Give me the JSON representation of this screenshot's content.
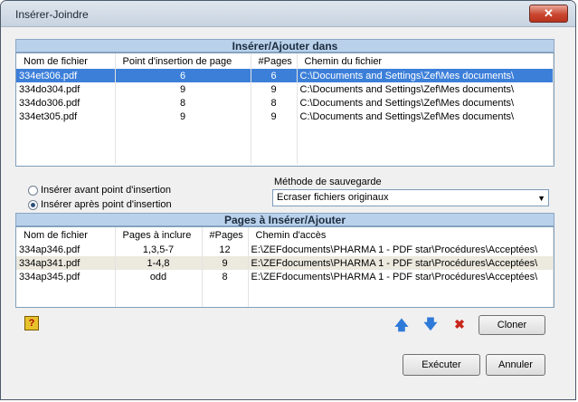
{
  "window": {
    "title": "Insérer-Joindre",
    "close_glyph": "✕"
  },
  "insert_section": {
    "header": "Insérer/Ajouter dans",
    "columns": [
      "Nom de fichier",
      "Point d'insertion de page",
      "#Pages",
      "Chemin du fichier"
    ],
    "rows": [
      [
        "334et306.pdf",
        "6",
        "6",
        "C:\\Documents and Settings\\Zef\\Mes documents\\"
      ],
      [
        "334do304.pdf",
        "9",
        "9",
        "C:\\Documents and Settings\\Zef\\Mes documents\\"
      ],
      [
        "334do306.pdf",
        "8",
        "8",
        "C:\\Documents and Settings\\Zef\\Mes documents\\"
      ],
      [
        "334et305.pdf",
        "9",
        "9",
        "C:\\Documents and Settings\\Zef\\Mes documents\\"
      ]
    ]
  },
  "options": {
    "radio_before": "Insérer avant point d'insertion",
    "radio_after": "Insérer après point d'insertion",
    "save_method_label": "Méthode de sauvegarde",
    "save_method_value": "Ecraser fichiers originaux"
  },
  "pages_section": {
    "header": "Pages à Insérer/Ajouter",
    "columns": [
      "Nom de fichier",
      "Pages à inclure",
      "#Pages",
      "Chemin d'accès"
    ],
    "rows": [
      [
        "334ap346.pdf",
        "1,3,5-7",
        "12",
        "E:\\ZEFdocuments\\PHARMA 1 - PDF star\\Procédures\\Acceptées\\"
      ],
      [
        "334ap341.pdf",
        "1-4,8",
        "9",
        "E:\\ZEFdocuments\\PHARMA 1 - PDF star\\Procédures\\Acceptées\\"
      ],
      [
        "334ap345.pdf",
        "odd",
        "8",
        "E:\\ZEFdocuments\\PHARMA 1 - PDF star\\Procédures\\Acceptées\\"
      ]
    ]
  },
  "toolbar": {
    "help_icon": "help-icon",
    "up_glyph": "🡅",
    "down_glyph": "🡇",
    "delete_glyph": "✖",
    "clone_label": "Cloner"
  },
  "footer": {
    "execute_label": "Exécuter",
    "cancel_label": "Annuler"
  },
  "colors": {
    "selection": "#3c7fd9",
    "header_band": "#b9d1ea",
    "arrow_blue": "#2f7ad8",
    "delete_red": "#c8261b"
  }
}
